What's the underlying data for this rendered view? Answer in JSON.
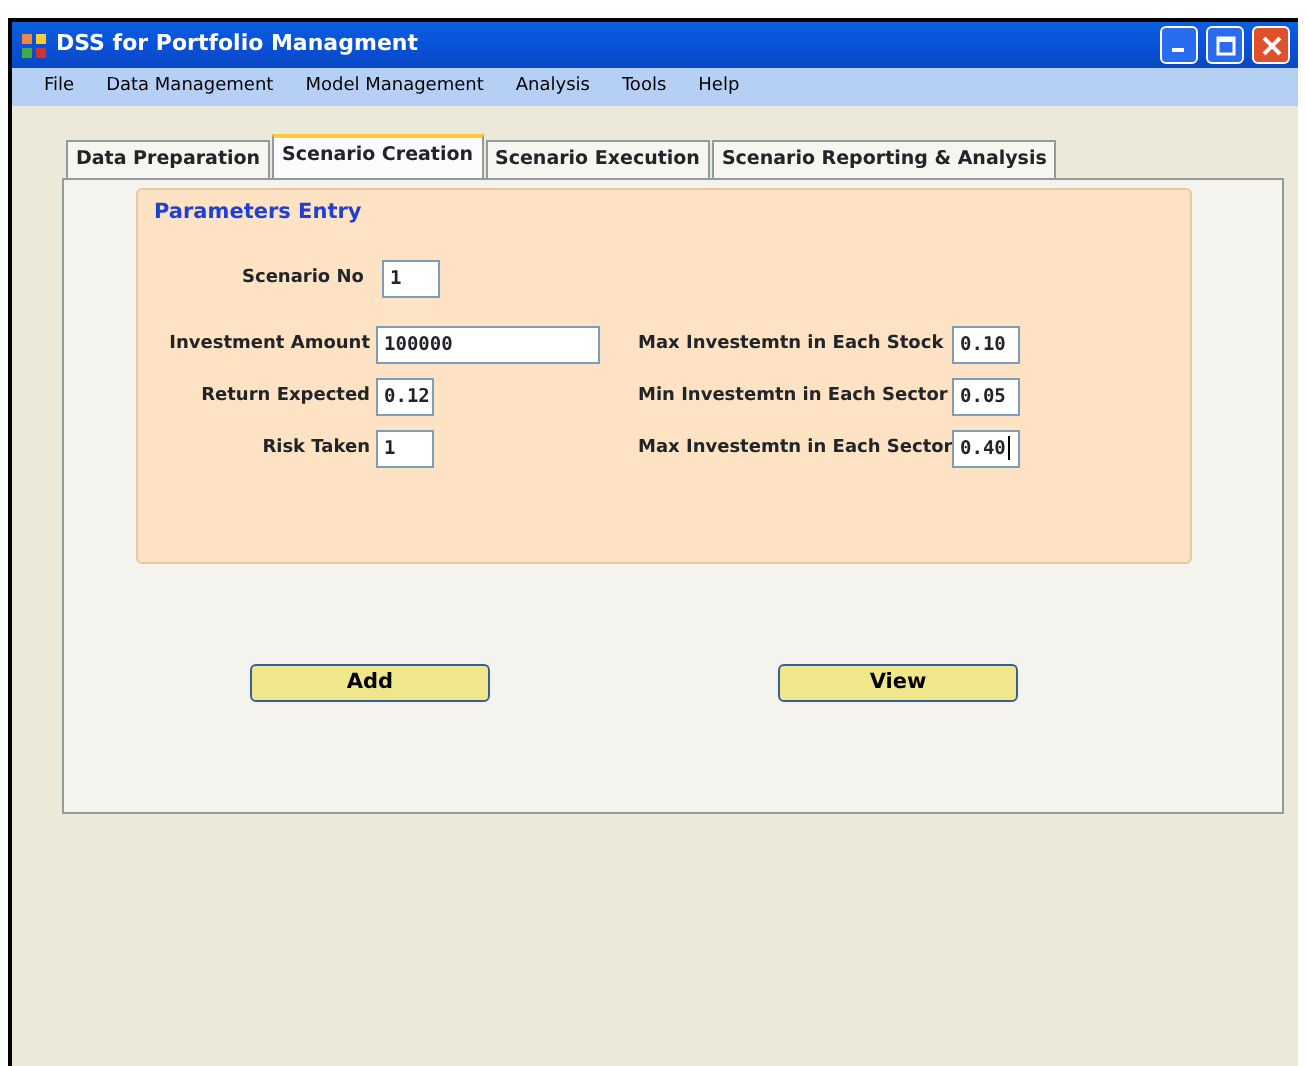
{
  "window": {
    "title": "DSS for Portfolio Managment"
  },
  "menu": [
    "File",
    "Data Management",
    "Model Management",
    "Analysis",
    "Tools",
    "Help"
  ],
  "tabs": [
    {
      "label": "Data Preparation",
      "selected": false
    },
    {
      "label": "Scenario Creation",
      "selected": true
    },
    {
      "label": "Scenario Execution",
      "selected": false
    },
    {
      "label": "Scenario Reporting & Analysis",
      "selected": false
    }
  ],
  "group": {
    "title": "Parameters Entry",
    "scenario_no": {
      "label": "Scenario No",
      "value": "1"
    },
    "left_fields": [
      {
        "label": "Investment Amount",
        "value": "100000",
        "kind": "wide"
      },
      {
        "label": "Return Expected",
        "value": "0.12",
        "kind": "short"
      },
      {
        "label": "Risk Taken",
        "value": "1",
        "kind": "short"
      }
    ],
    "right_fields": [
      {
        "label": "Max Investemtn in Each Stock",
        "value": "0.10",
        "focused": false
      },
      {
        "label": "Min Investemtn in Each Sector",
        "value": "0.05",
        "focused": false
      },
      {
        "label": "Max Investemtn in Each Sector",
        "value": "0.40",
        "focused": true
      }
    ]
  },
  "buttons": [
    "Add",
    "View"
  ]
}
